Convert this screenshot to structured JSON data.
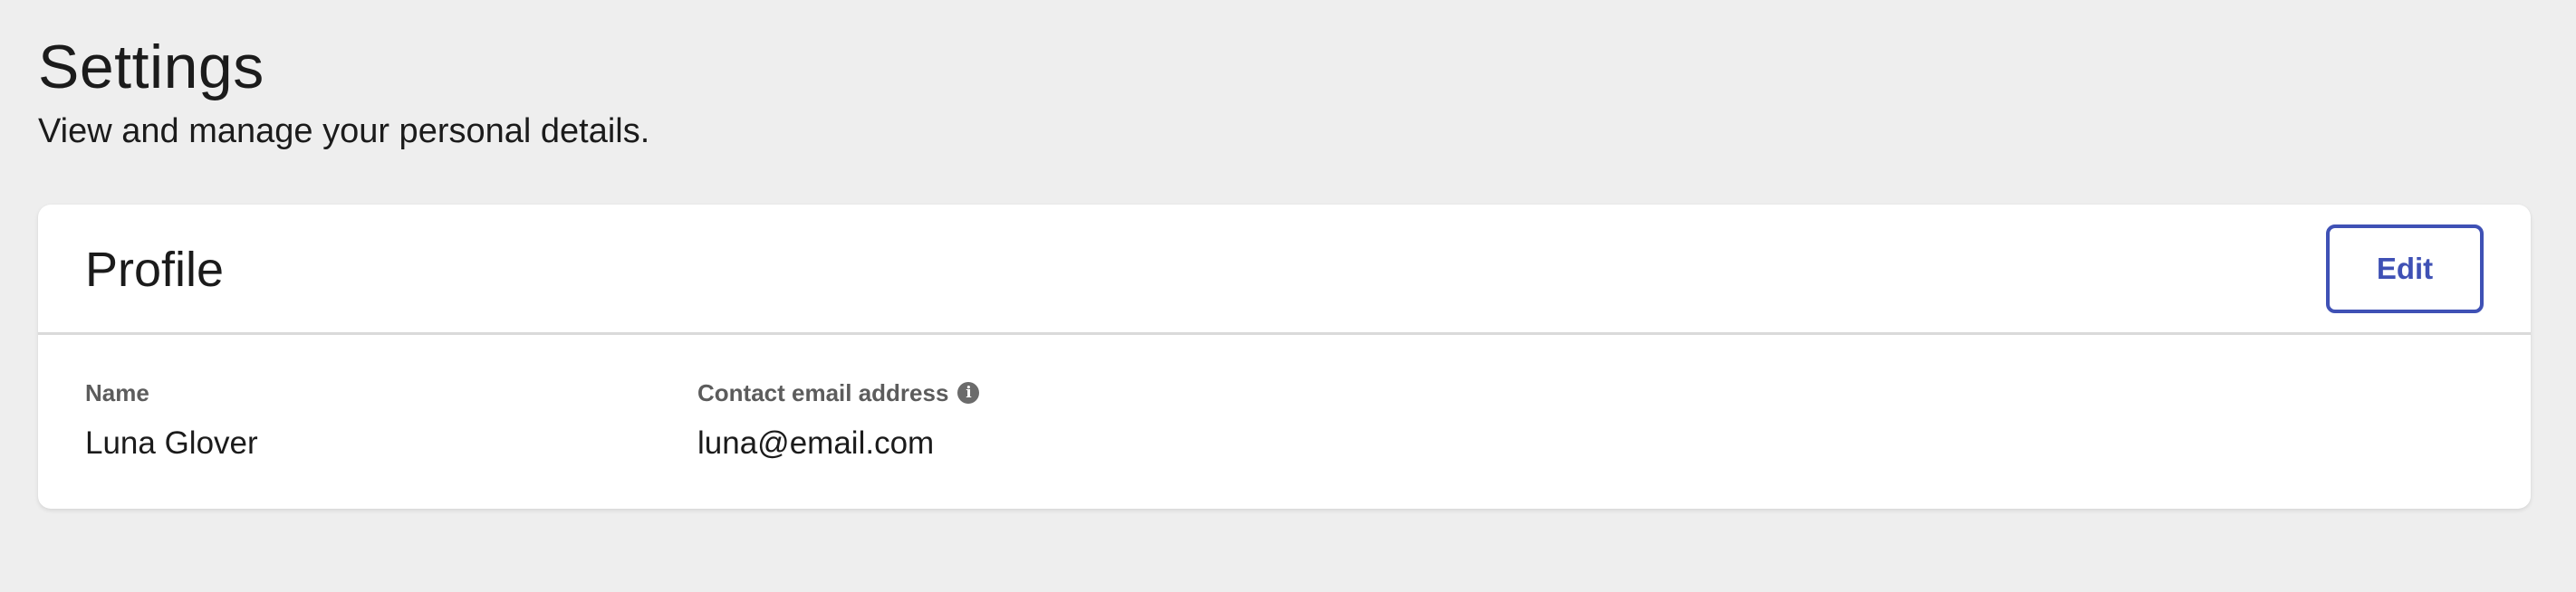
{
  "page": {
    "title": "Settings",
    "subtitle": "View and manage your personal details."
  },
  "profile_card": {
    "title": "Profile",
    "edit_label": "Edit",
    "fields": [
      {
        "label": "Name",
        "value": "Luna Glover"
      },
      {
        "label": "Contact email address",
        "value": "luna@email.com",
        "icon": "info-icon"
      }
    ]
  },
  "colors": {
    "background": "#eeeeee",
    "card": "#ffffff",
    "accent": "#3f51b5",
    "text": "#1b1b1b",
    "muted_text": "#5c5c5c",
    "divider": "#dadada"
  }
}
